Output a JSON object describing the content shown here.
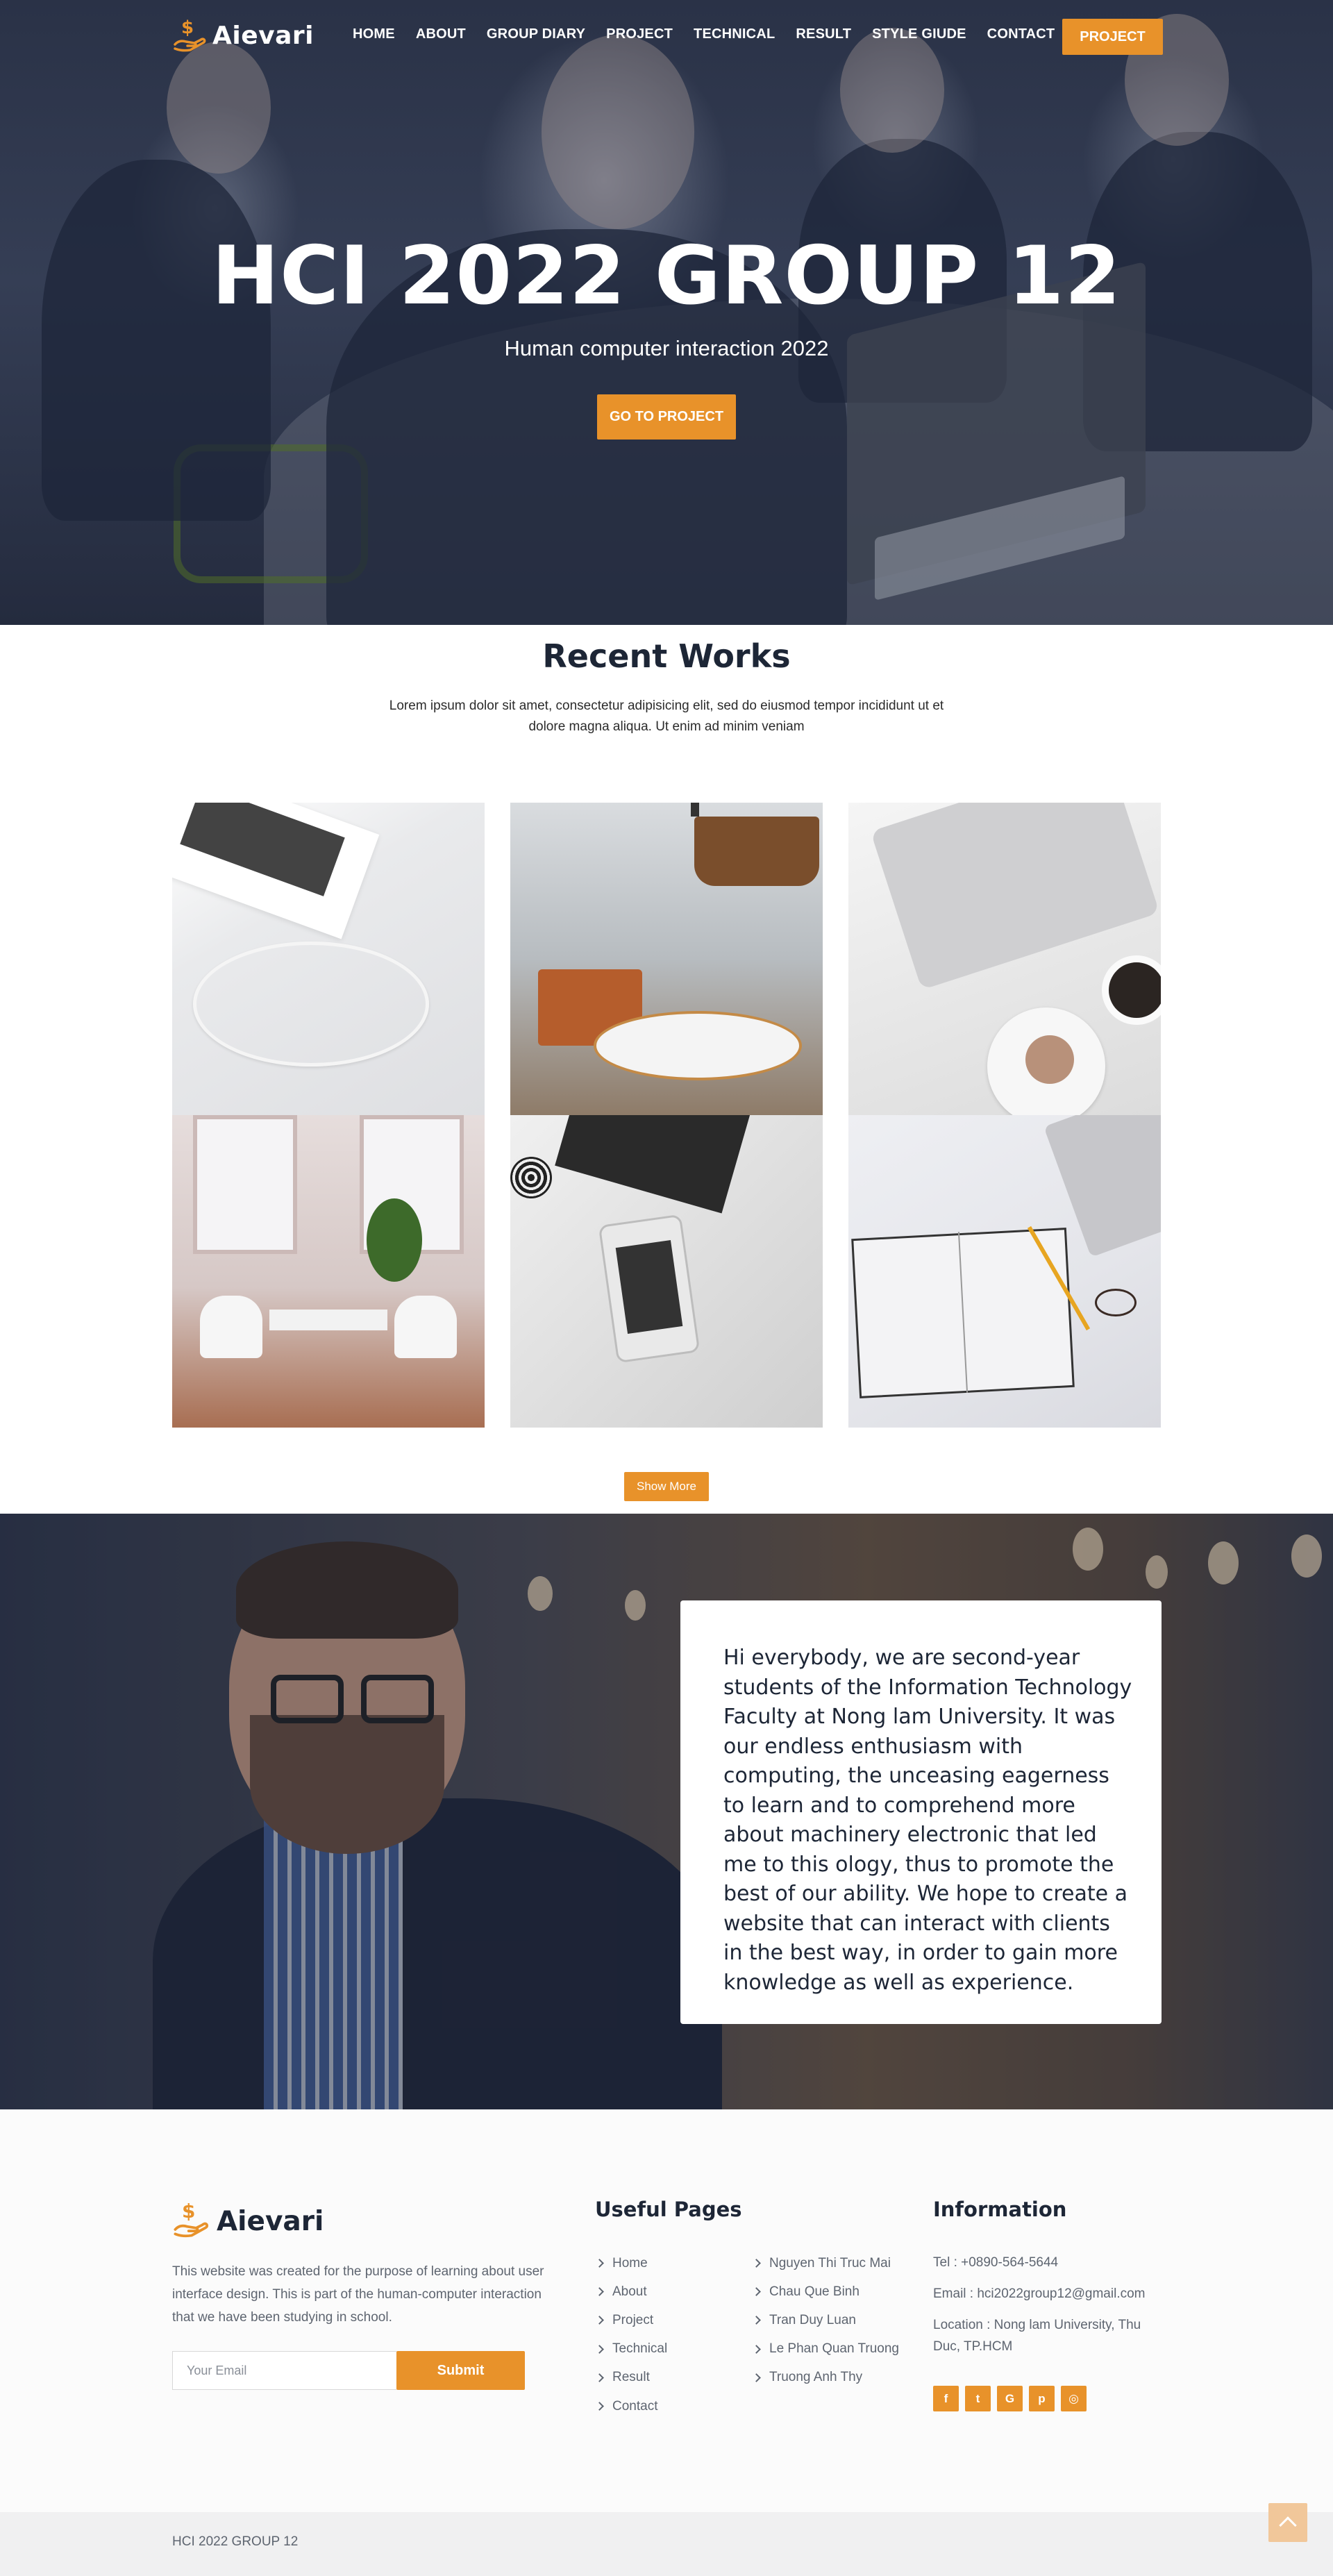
{
  "brand": {
    "name": "Aievari",
    "accent": "#e8922a",
    "logo_icon": "dollar-hand-icon"
  },
  "nav": {
    "items": [
      "HOME",
      "ABOUT",
      "GROUP DIARY",
      "PROJECT",
      "TECHNICAL",
      "RESULT",
      "STYLE GIUDE",
      "CONTACT"
    ],
    "cta": "PROJECT"
  },
  "hero": {
    "title": "HCI 2022 GROUP 12",
    "subtitle": "Human computer interaction 2022",
    "button": "GO TO PROJECT"
  },
  "works": {
    "title": "Recent Works",
    "description": "Lorem ipsum dolor sit amet, consectetur adipisicing elit, sed do eiusmod tempor incididunt ut et dolore magna aliqua. Ut enim ad minim veniam",
    "show_more": "Show More"
  },
  "about": {
    "text": "Hi everybody, we are second-year students of the Information Technology Faculty at Nong lam University. It was our endless enthusiasm with computing, the unceasing eagerness to learn and to comprehend more about machinery electronic that led me to this ology, thus to promote the best of our ability. We hope to create a website that can interact with clients in the best way, in order to gain more knowledge as well as experience."
  },
  "footer": {
    "logo_text": "Aievari",
    "about": "This website was created for the purpose of learning about user interface design. This is part of the human-computer interaction that we have been studying in school.",
    "email_placeholder": "Your Email",
    "submit": "Submit",
    "useful_title": "Useful Pages",
    "pages": [
      "Home",
      "About",
      "Project",
      "Technical",
      "Result",
      "Contact"
    ],
    "members": [
      "Nguyen Thi Truc Mai",
      "Chau Que Binh",
      "Tran Duy Luan",
      "Le Phan Quan Truong",
      "Truong Anh Thy"
    ],
    "info_title": "Information",
    "tel": "Tel : +0890-564-5644",
    "email": "Email : hci2022group12@gmail.com",
    "location": "Location : Nong lam University, Thu Duc, TP.HCM",
    "social": [
      {
        "glyph": "f",
        "icon": "facebook-icon"
      },
      {
        "glyph": "t",
        "icon": "twitter-icon"
      },
      {
        "glyph": "G",
        "icon": "google-icon"
      },
      {
        "glyph": "p",
        "icon": "pinterest-icon"
      },
      {
        "glyph": "◎",
        "icon": "instagram-icon"
      }
    ],
    "copyright": "HCI 2022 GROUP 12"
  }
}
